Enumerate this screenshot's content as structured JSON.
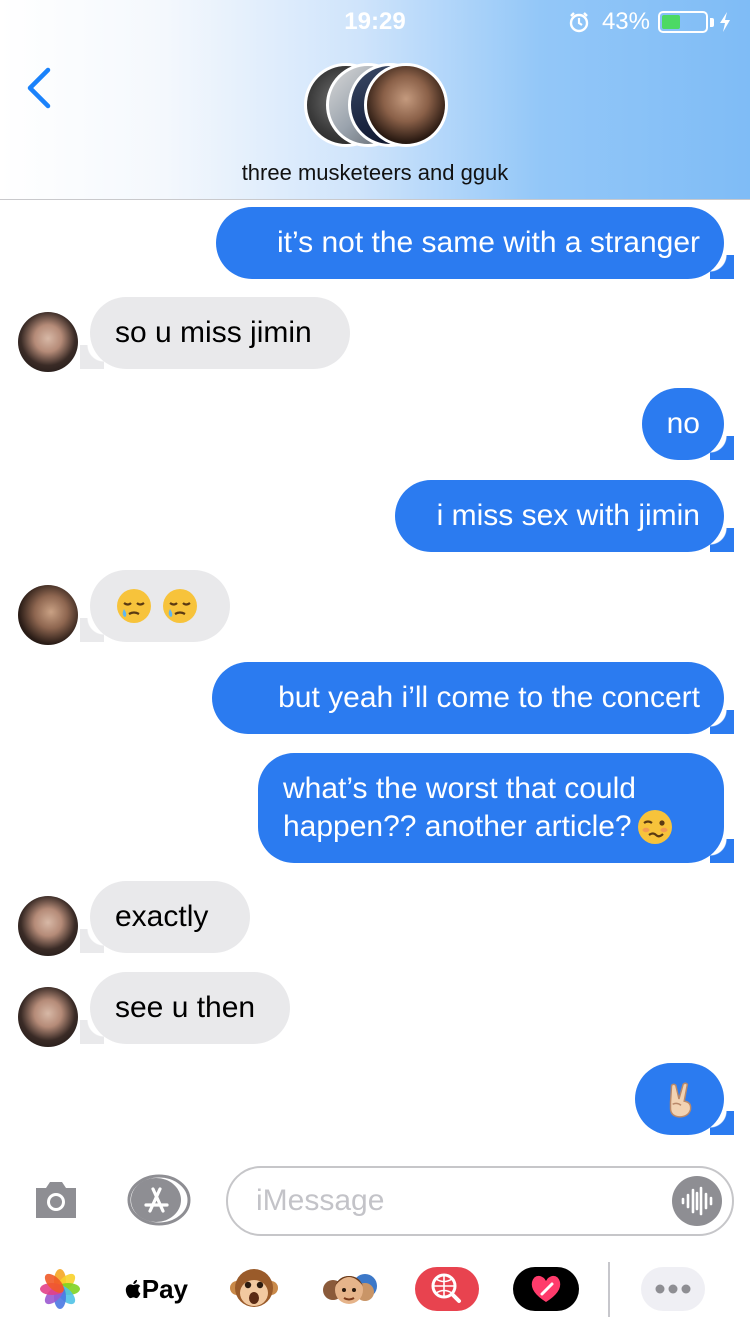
{
  "status_bar": {
    "time": "19:29",
    "battery": "43%",
    "battery_level": 0.43
  },
  "header": {
    "group_name": "three musketeers and gguk"
  },
  "messages": [
    {
      "from": "me",
      "text": "it’s not the same with a stranger"
    },
    {
      "from": "them",
      "text": "so u miss jimin"
    },
    {
      "from": "me",
      "text": "no"
    },
    {
      "from": "me",
      "text": "i miss sex with jimin"
    },
    {
      "from": "them",
      "emoji": [
        "sleepy-face-emoji",
        "sleepy-face-emoji"
      ]
    },
    {
      "from": "me",
      "text": "but yeah i’ll come to the concert"
    },
    {
      "from": "me",
      "lines": [
        "what’s the worst that could",
        "happen?? another article?"
      ],
      "emoji": "woozy-face-emoji"
    },
    {
      "from": "them",
      "text": "exactly"
    },
    {
      "from": "them",
      "text": "see u then"
    },
    {
      "from": "me",
      "emoji": "victory-hand-emoji"
    }
  ],
  "input": {
    "placeholder": "iMessage"
  },
  "apps": {
    "apple_pay_label": "Pay"
  },
  "colors": {
    "sent_bubble": "#2b7bf0",
    "received_bubble": "#e9e9eb",
    "icon_gray": "#8e8e93"
  }
}
